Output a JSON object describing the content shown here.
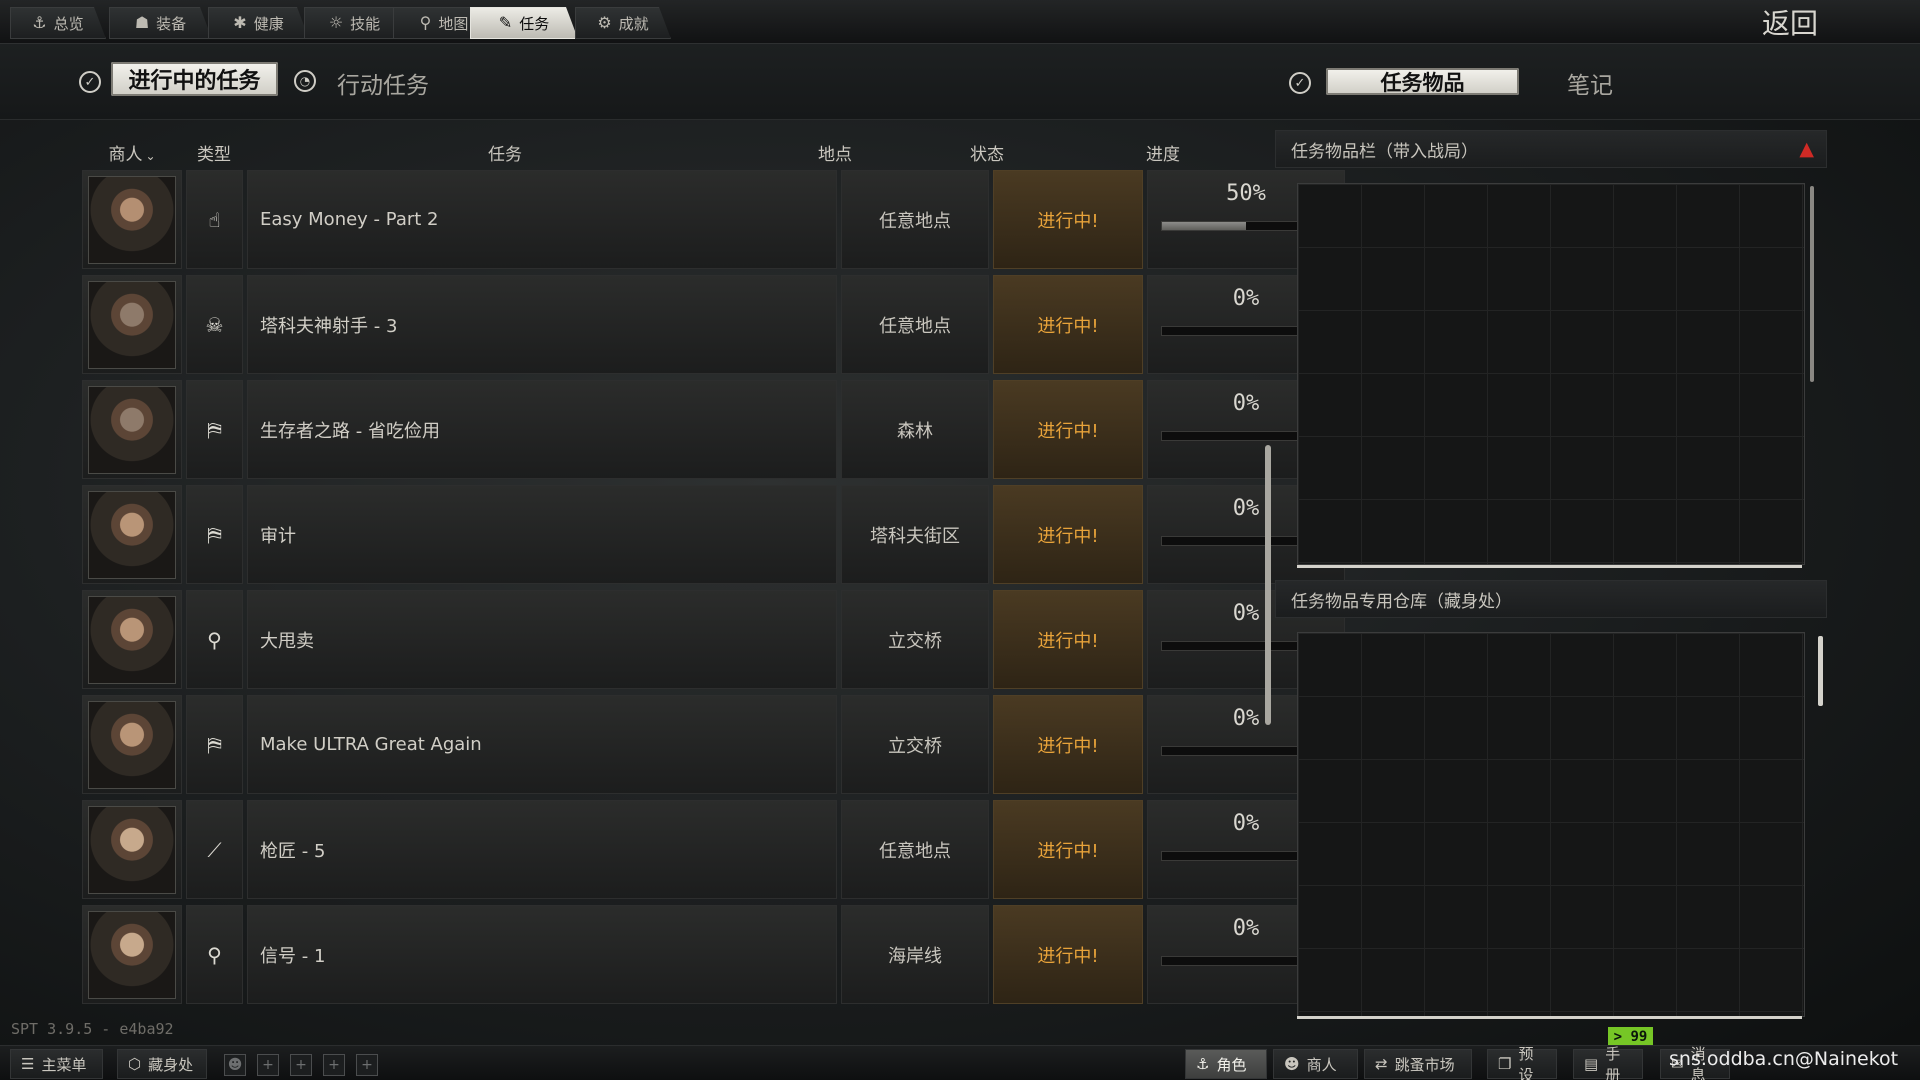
{
  "top_nav": [
    {
      "label": "总览",
      "icon": "person-icon",
      "glyph": "⚓"
    },
    {
      "label": "装备",
      "icon": "gear-vest-icon",
      "glyph": "☗"
    },
    {
      "label": "健康",
      "icon": "health-icon",
      "glyph": "✱"
    },
    {
      "label": "技能",
      "icon": "skills-icon",
      "glyph": "☼"
    },
    {
      "label": "地图",
      "icon": "map-pin-icon",
      "glyph": "⚲"
    },
    {
      "label": "任务",
      "icon": "tasks-icon",
      "glyph": "✎",
      "active": true
    },
    {
      "label": "成就",
      "icon": "achievements-icon",
      "glyph": "⚙"
    }
  ],
  "back_label": "返回",
  "left_header": {
    "active_tab": "进行中的任务",
    "inactive_tab": "行动任务"
  },
  "right_header": {
    "active_tab": "任务物品",
    "inactive_tab": "笔记"
  },
  "columns": {
    "trader": "商人",
    "type": "类型",
    "task": "任务",
    "location": "地点",
    "status": "状态",
    "progress": "进度"
  },
  "tasks": [
    {
      "name": "Easy Money - Part 2",
      "type_icon": "hand-icon",
      "type_glyph": "☝",
      "location": "任意地点",
      "status": "进行中!",
      "progress_label": "50%",
      "progress": 0.5
    },
    {
      "name": "塔科夫神射手 - 3",
      "type_icon": "skull-icon",
      "type_glyph": "☠",
      "location": "任意地点",
      "status": "进行中!",
      "progress_label": "0%",
      "progress": 0
    },
    {
      "name": "生存者之路 - 省吃俭用",
      "type_icon": "exit-icon",
      "type_glyph": "⛿",
      "location": "森林",
      "status": "进行中!",
      "progress_label": "0%",
      "progress": 0
    },
    {
      "name": "审计",
      "type_icon": "exit-icon",
      "type_glyph": "⛿",
      "location": "塔科夫街区",
      "status": "进行中!",
      "progress_label": "0%",
      "progress": 0
    },
    {
      "name": "大甩卖",
      "type_icon": "search-icon",
      "type_glyph": "⚲",
      "location": "立交桥",
      "status": "进行中!",
      "progress_label": "0%",
      "progress": 0
    },
    {
      "name": "Make ULTRA Great Again",
      "type_icon": "exit-icon",
      "type_glyph": "⛿",
      "location": "立交桥",
      "status": "进行中!",
      "progress_label": "0%",
      "progress": 0
    },
    {
      "name": "枪匠 - 5",
      "type_icon": "rifle-icon",
      "type_glyph": "⟋",
      "location": "任意地点",
      "status": "进行中!",
      "progress_label": "0%",
      "progress": 0
    },
    {
      "name": "信号 - 1",
      "type_icon": "map-pin-icon",
      "type_glyph": "⚲",
      "location": "海岸线",
      "status": "进行中!",
      "progress_label": "0%",
      "progress": 0
    }
  ],
  "panels": {
    "quest_items_raid": "任务物品栏（带入战局）",
    "quest_items_stash": "任务物品专用仓库（藏身处）"
  },
  "version": "SPT 3.9.5 - e4ba92",
  "bottom_bar": {
    "left": [
      {
        "label": "主菜单",
        "icon": "menu-icon",
        "glyph": "☰"
      },
      {
        "label": "藏身处",
        "icon": "hideout-icon",
        "glyph": "⬡"
      }
    ],
    "right": [
      {
        "label": "角色",
        "icon": "character-icon",
        "glyph": "⚓",
        "active": true
      },
      {
        "label": "商人",
        "icon": "traders-icon",
        "glyph": "☻"
      },
      {
        "label": "跳蚤市场",
        "icon": "flea-market-icon",
        "glyph": "⇄"
      },
      {
        "label": "预设",
        "icon": "presets-icon",
        "glyph": "❐"
      },
      {
        "label": "手册",
        "icon": "handbook-icon",
        "glyph": "▤"
      },
      {
        "label": "消息",
        "icon": "messages-icon",
        "glyph": "✉"
      }
    ]
  },
  "badge": "> 99",
  "watermark": "sns.oddba.cn@Nainekot",
  "colors": {
    "status_text": "#e8a33a",
    "badge": "#76c626",
    "active_tab_bg": "#e6e5df"
  }
}
